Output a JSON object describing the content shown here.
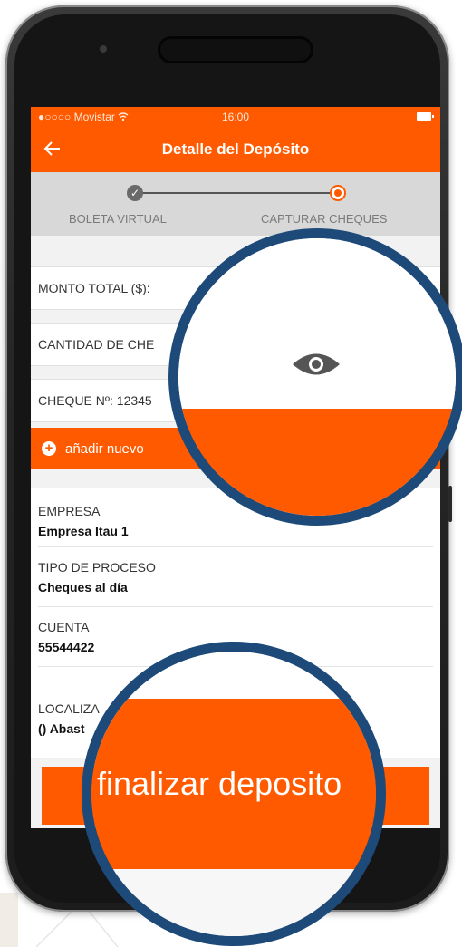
{
  "status_bar": {
    "carrier": "●○○○○ Movistar",
    "time": "16:00"
  },
  "header": {
    "title": "Detalle del Depósito",
    "back_icon": "arrow-left-icon"
  },
  "stepper": {
    "steps": [
      {
        "label": "BOLETA VIRTUAL",
        "state": "done"
      },
      {
        "label": "CAPTURAR CHEQUES",
        "state": "active"
      }
    ]
  },
  "form": {
    "monto_total_label": "MONTO TOTAL ($):",
    "cantidad_cheques_label": "CANTIDAD DE CHE",
    "cheque_label": "CHEQUE Nº: 12345",
    "add_new_label": "añadir nuevo"
  },
  "details": [
    {
      "label": "EMPRESA",
      "value": "Empresa Itau 1"
    },
    {
      "label": "TIPO DE PROCESO",
      "value": "Cheques al día"
    },
    {
      "label": "CUENTA",
      "value": "55544422"
    },
    {
      "label": "LOCALIZA",
      "value": "() Abast"
    }
  ],
  "zoom": {
    "eye_icon": "eye-icon",
    "finish_button_label": "finalizar deposito"
  },
  "colors": {
    "accent": "#ff5a00",
    "zoom_ring": "#1d4a78"
  }
}
